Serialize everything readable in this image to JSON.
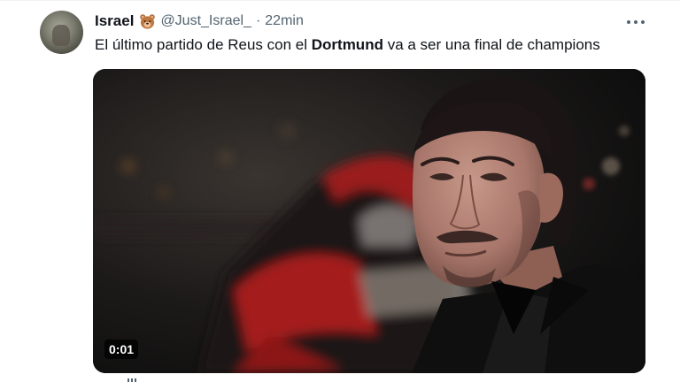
{
  "tweet": {
    "author_name": "Israel",
    "author_emoji": "bear-face",
    "handle": "@Just_Israel_",
    "separator": "·",
    "time": "22min",
    "text_before": "El último partido de Reus con el ",
    "text_bold": "Dortmund",
    "text_after": " va a ser una final de champions",
    "more_icon": "more-horizontal-icon"
  },
  "media": {
    "type": "video",
    "timestamp": "0:01"
  },
  "colors": {
    "text": "#0f1419",
    "secondary": "#536471",
    "badge_bg": "#000000"
  }
}
